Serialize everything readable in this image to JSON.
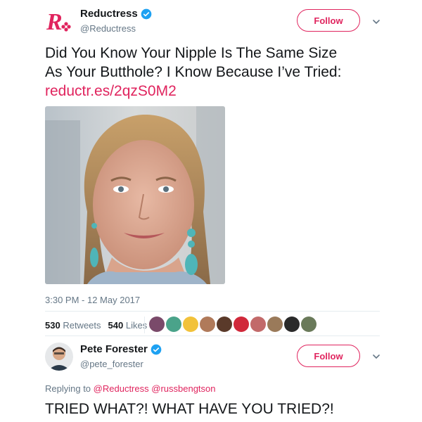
{
  "tweet1": {
    "author_name": "Reductress",
    "handle": "@Reductress",
    "follow_label": "Follow",
    "text_line1": "Did You Know Your Nipple Is The Same Size",
    "text_line2": "As Your Butthole? I Know Because I’ve Tried:",
    "link": "reductr.es/2qzS0M2",
    "timestamp": "3:30 PM - 12 May 2017",
    "retweets_count": "530",
    "retweets_label": "Retweets",
    "likes_count": "540",
    "likes_label": "Likes"
  },
  "tweet2": {
    "author_name": "Pete Forester",
    "handle": "@pete_forester",
    "follow_label": "Follow",
    "replying_prefix": "Replying to",
    "mention1": "@Reductress",
    "mention2": "@russbengtson",
    "text": "TRIED WHAT?! WHAT HAVE YOU TRIED?!"
  },
  "colors": {
    "accent": "#e0245e",
    "verified": "#1da1f2",
    "muted": "#657786",
    "text": "#14171a"
  }
}
